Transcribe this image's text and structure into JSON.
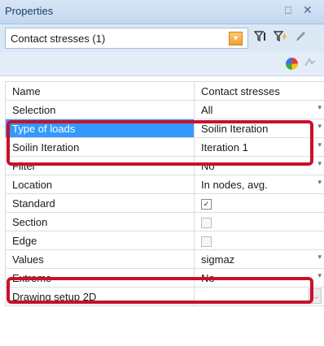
{
  "panel": {
    "title": "Properties",
    "pin_glyph": "⎕",
    "close_glyph": "✕"
  },
  "selector": {
    "value": "Contact stresses (1)",
    "dropdown_glyph": "▼"
  },
  "toolbar_icons": [
    "filter-icon",
    "filter-lightning-icon",
    "pencil-icon",
    "pie-chart-icon",
    "drawing-icon"
  ],
  "properties": [
    {
      "name": "Name",
      "value": "Contact stresses",
      "control": "text"
    },
    {
      "name": "Selection",
      "value": "All",
      "control": "dropdown"
    },
    {
      "name": "Type of loads",
      "value": "Soilin Iteration",
      "control": "dropdown",
      "selected": true
    },
    {
      "name": "Soilin Iteration",
      "value": "Iteration 1",
      "control": "dropdown"
    },
    {
      "name": "Filter",
      "value": "No",
      "control": "dropdown"
    },
    {
      "name": "Location",
      "value": "In nodes, avg.",
      "control": "dropdown"
    },
    {
      "name": "Standard",
      "value": "",
      "control": "checkbox",
      "checked": true
    },
    {
      "name": "Section",
      "value": "",
      "control": "checkbox",
      "checked": false
    },
    {
      "name": "Edge",
      "value": "",
      "control": "checkbox",
      "checked": false
    },
    {
      "name": "Values",
      "value": "sigmaz",
      "control": "dropdown"
    },
    {
      "name": "Extreme",
      "value": "No",
      "control": "dropdown"
    },
    {
      "name": "Drawing setup 2D",
      "value": "",
      "control": "ellipsis"
    }
  ],
  "glyphs": {
    "dropdown": "▾",
    "check": "✓",
    "ellipsis": "..."
  },
  "colors": {
    "selected_row": "#3399ff",
    "highlight_frame": "#c8102e"
  }
}
